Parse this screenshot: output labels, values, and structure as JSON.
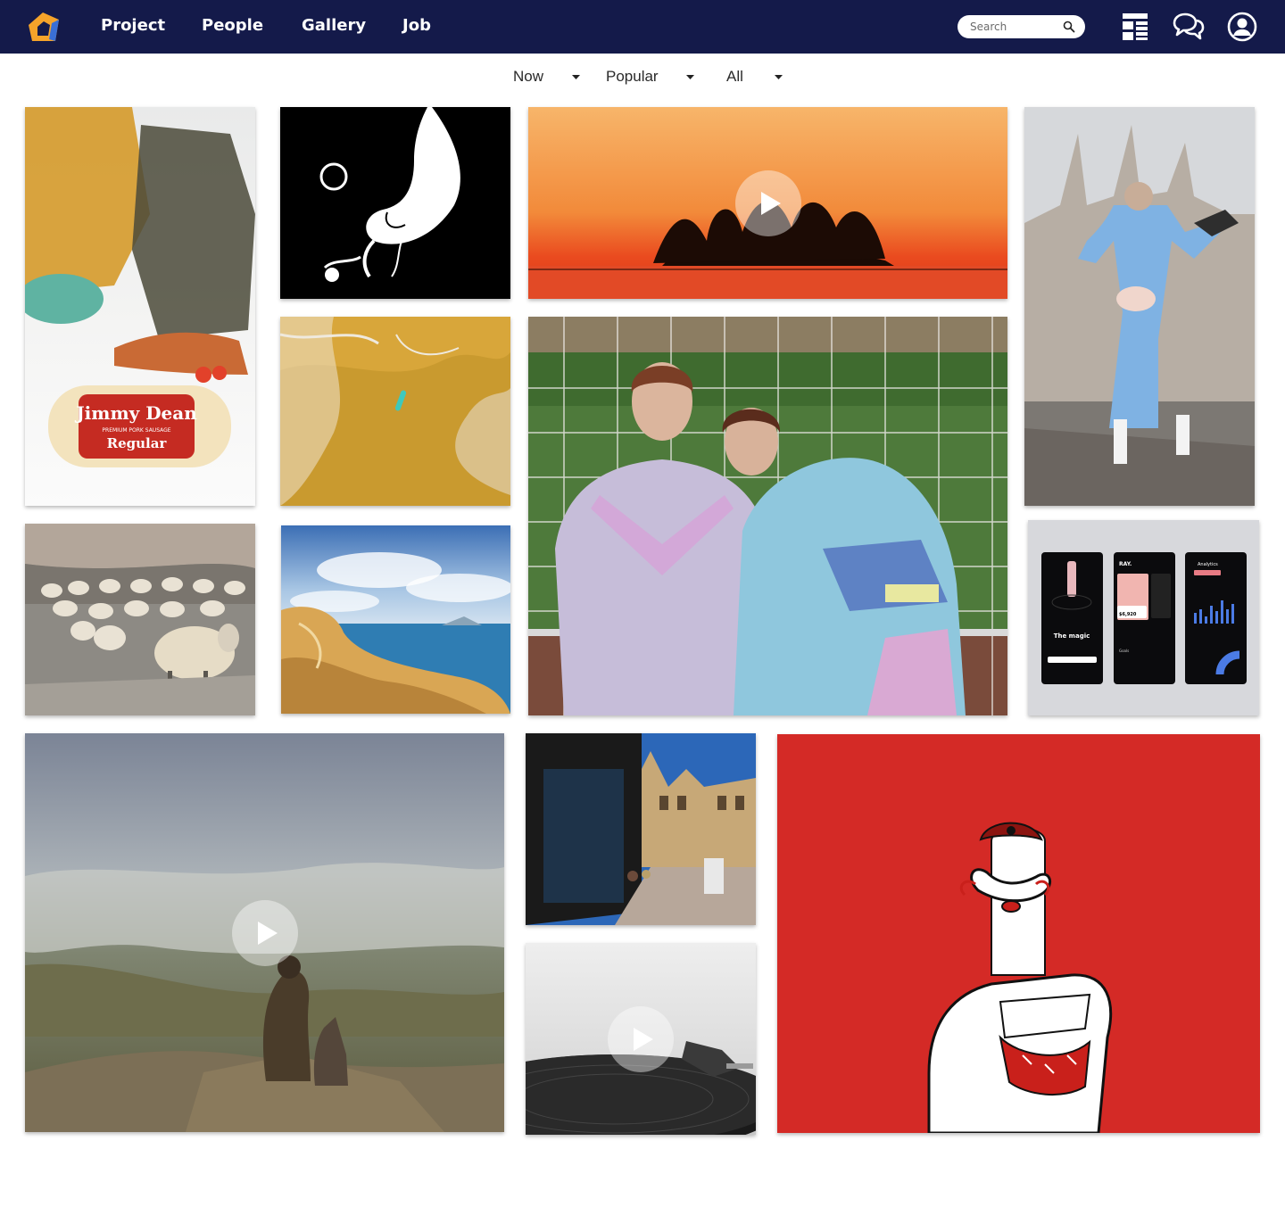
{
  "nav": {
    "items": [
      {
        "label": "Project"
      },
      {
        "label": "People"
      },
      {
        "label": "Gallery"
      },
      {
        "label": "Job"
      }
    ],
    "search_placeholder": "Search",
    "brand_color": "#141a4a",
    "logo_colors": [
      "#f5a32a",
      "#3a6fd6"
    ]
  },
  "filters": [
    {
      "label": "Now",
      "icon": "caret-down-icon"
    },
    {
      "label": "Popular",
      "icon": "caret-down-icon"
    },
    {
      "label": "All",
      "icon": "caret-down-icon"
    }
  ],
  "icons": {
    "search": "search-icon",
    "layout": "layout-icon",
    "chat": "chat-bubbles-icon",
    "account": "user-account-icon",
    "play": "play-icon"
  },
  "tiles": [
    {
      "subject": "food sausage pack",
      "printed_text": [
        "Jimmy Dean",
        "PREMIUM PORK SAUSAGE",
        "Regular"
      ],
      "video": false
    },
    {
      "subject": "black and white hand illustration",
      "printed_text": [],
      "video": false
    },
    {
      "subject": "sunset island trees",
      "printed_text": [],
      "video": true
    },
    {
      "subject": "woman with pigeons at cathedral",
      "printed_text": [],
      "video": false
    },
    {
      "subject": "aerial sand and sea",
      "printed_text": [],
      "video": false
    },
    {
      "subject": "two girls at football goal net",
      "printed_text": [],
      "video": false
    },
    {
      "subject": "mobile app screens",
      "printed_text": [
        "The magic",
        "RAY.",
        "$6,920",
        "Goals",
        "Analytics"
      ],
      "video": false
    },
    {
      "subject": "flock of sheep",
      "printed_text": [],
      "video": false
    },
    {
      "subject": "rocky coast",
      "printed_text": [],
      "video": false
    },
    {
      "subject": "hiker with dog over foggy valley",
      "printed_text": [],
      "video": true
    },
    {
      "subject": "old town street",
      "printed_text": [],
      "video": false
    },
    {
      "subject": "record turntable",
      "printed_text": [],
      "video": true
    },
    {
      "subject": "moustached finger character on red",
      "printed_text": [],
      "video": false
    }
  ]
}
